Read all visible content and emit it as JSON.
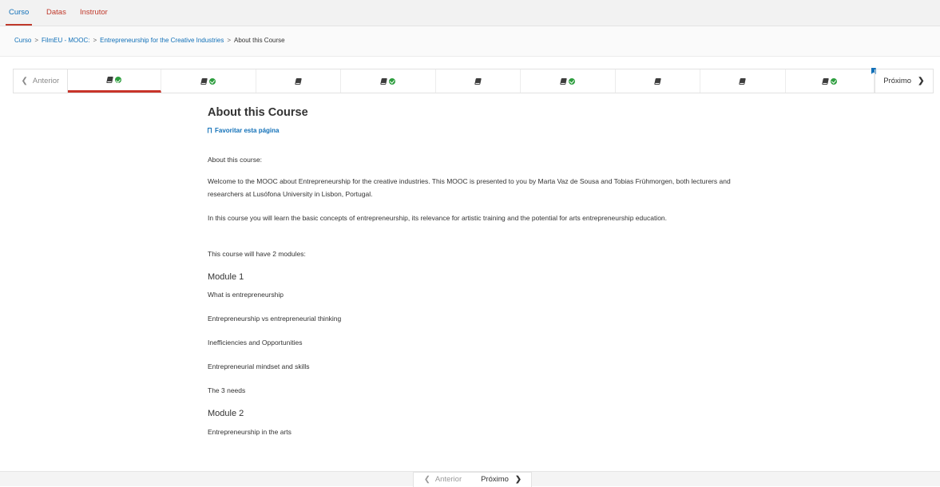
{
  "tabs": [
    "Curso",
    "Datas",
    "Instrutor"
  ],
  "breadcrumb": {
    "items": [
      "Curso",
      "FilmEU - MOOC:",
      "Entrepreneurship for the Creative Industries"
    ],
    "current": "About this Course",
    "separator": ">"
  },
  "sequence_nav": {
    "prev_label": "Anterior",
    "next_label": "Próximo",
    "units": [
      {
        "icon": "book-icon",
        "complete": true,
        "active": true
      },
      {
        "icon": "book-icon",
        "complete": true,
        "active": false
      },
      {
        "icon": "book-icon",
        "complete": false,
        "active": false
      },
      {
        "icon": "book-icon",
        "complete": true,
        "active": false
      },
      {
        "icon": "book-icon",
        "complete": false,
        "active": false
      },
      {
        "icon": "book-icon",
        "complete": true,
        "active": false
      },
      {
        "icon": "book-icon",
        "complete": false,
        "active": false
      },
      {
        "icon": "book-icon",
        "complete": false,
        "active": false
      },
      {
        "icon": "book-icon",
        "complete": true,
        "active": false,
        "bookmarked": true
      }
    ]
  },
  "content": {
    "title": "About this Course",
    "bookmark_label": "Favoritar esta página",
    "intro": "About this course:",
    "para1": "Welcome to the MOOC about Entrepreneurship for the creative industries. This MOOC is presented to you by Marta Vaz de Sousa and Tobias Frühmorgen, both lecturers and researchers at Lusófona University in Lisbon, Portugal.",
    "para2": "In this course you will learn the basic concepts of entrepreneurship, its relevance for artistic training and the potential for arts entrepreneurship education.",
    "para3": "This course will have 2 modules:",
    "module1": {
      "heading": "Module 1",
      "items": [
        "What is entrepreneurship",
        "Entrepreneurship vs entrepreneurial thinking",
        "Inefficiencies and Opportunities",
        "Entrepreneurial mindset and skills",
        "The 3 needs"
      ]
    },
    "module2": {
      "heading": "Module 2",
      "items": [
        "Entrepreneurship in the arts"
      ]
    }
  },
  "bottom_nav": {
    "prev_label": "Anterior",
    "next_label": "Próximo"
  },
  "colors": {
    "accent_red": "#c8342a",
    "link_blue": "#1170b8",
    "check_green": "#2e9e3f"
  }
}
